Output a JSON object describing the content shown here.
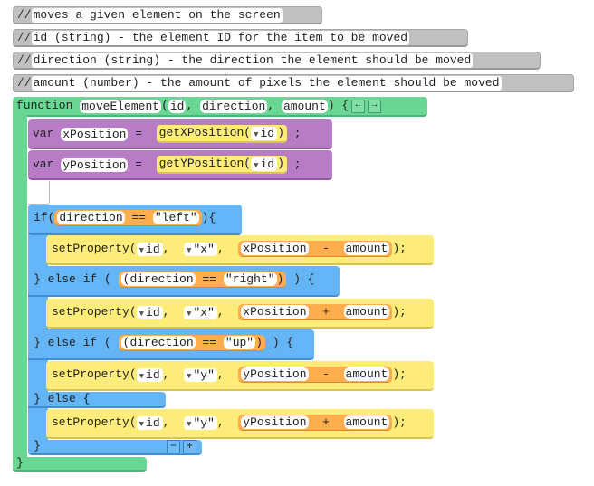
{
  "comments": [
    {
      "prefix": "//",
      "text": "moves a given element on the screen"
    },
    {
      "prefix": "//",
      "text": "id (string) - the element ID for the item to be moved"
    },
    {
      "prefix": "//",
      "text": "direction (string) - the direction the element should be moved"
    },
    {
      "prefix": "//",
      "text": "amount (number) - the amount of pixels the element should be moved"
    }
  ],
  "function": {
    "keyword": "function",
    "name": "moveElement",
    "open_paren": "(",
    "params": [
      "id",
      "direction",
      "amount"
    ],
    "comma": ",",
    "close": ") {",
    "remove_param_label": "←",
    "add_param_label": "→",
    "closing_brace": "}"
  },
  "vars": [
    {
      "keyword": "var",
      "name": "xPosition",
      "eq": "=",
      "call": "getXPosition(",
      "arg": "id",
      "end": ")",
      "semi": ";"
    },
    {
      "keyword": "var",
      "name": "yPosition",
      "eq": "=",
      "call": "getYPosition(",
      "arg": "id",
      "end": ")",
      "semi": ";"
    }
  ],
  "if_block": {
    "branches": [
      {
        "header_pre": "if(",
        "cond_var": "direction",
        "cond_op": "==",
        "cond_val": "\"left\"",
        "header_post": "){",
        "stmt": {
          "call": "setProperty(",
          "id": "id",
          "comma": ",",
          "prop": "\"x\"",
          "lhs": "xPosition",
          "op": "-",
          "rhs": "amount",
          "end": ");"
        }
      },
      {
        "header_pre": "} else if (",
        "cond_var": "(direction",
        "cond_op": "==",
        "cond_val": "\"right\"",
        "cond_close": ")",
        "header_post": ") {",
        "stmt": {
          "call": "setProperty(",
          "id": "id",
          "comma": ",",
          "prop": "\"x\"",
          "lhs": "xPosition",
          "op": "+",
          "rhs": "amount",
          "end": ");"
        }
      },
      {
        "header_pre": "} else if (",
        "cond_var": "(direction",
        "cond_op": "==",
        "cond_val": "\"up\"",
        "cond_close": ")",
        "header_post": ") {",
        "stmt": {
          "call": "setProperty(",
          "id": "id",
          "comma": ",",
          "prop": "\"y\"",
          "lhs": "yPosition",
          "op": "-",
          "rhs": "amount",
          "end": ");"
        }
      },
      {
        "header_pre": "} else {",
        "stmt": {
          "call": "setProperty(",
          "id": "id",
          "comma": ",",
          "prop": "\"y\"",
          "lhs": "yPosition",
          "op": "+",
          "rhs": "amount",
          "end": ");"
        }
      }
    ],
    "closing_brace": "}",
    "remove_branch_label": "−",
    "add_branch_label": "+"
  },
  "icons": {
    "dropdown": "▼"
  },
  "colors": {
    "comment": "#c0c0c0",
    "function": "#6ad694",
    "variable": "#b87cc7",
    "control": "#64b5f6",
    "call": "#fdeb7a",
    "operator": "#ffad4d"
  }
}
